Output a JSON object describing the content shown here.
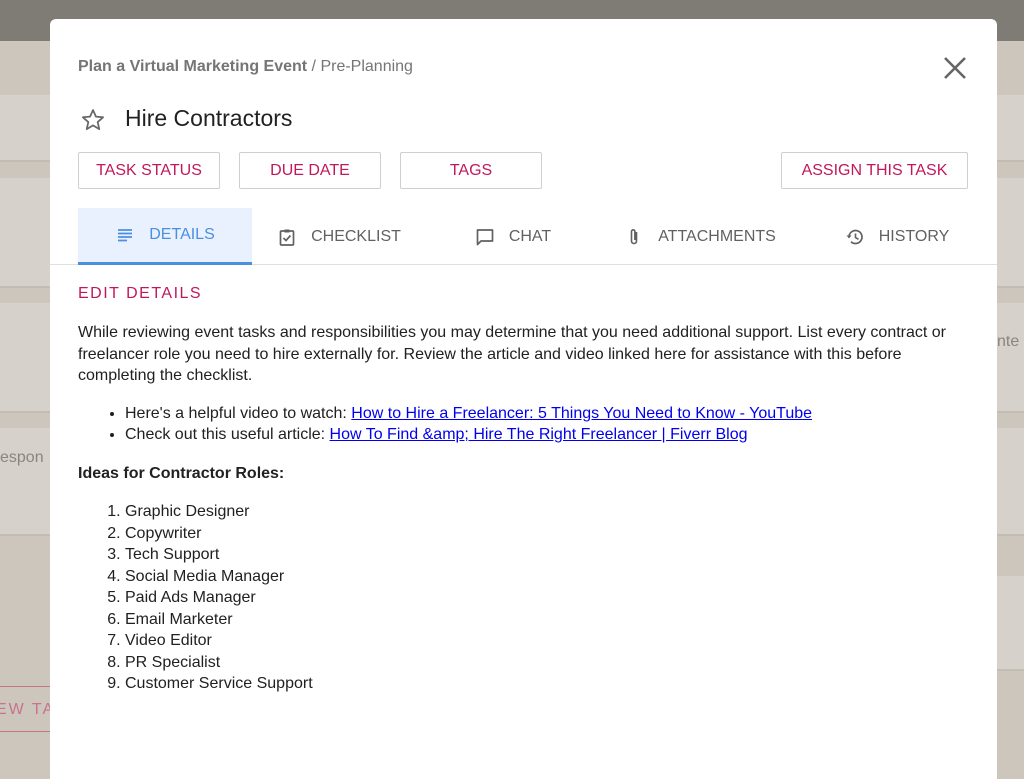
{
  "background": {
    "partial_text_1": "espon",
    "partial_text_2": "nte",
    "partial_button": "EW TA"
  },
  "breadcrumb": {
    "project": "Plan a Virtual Marketing Event",
    "separator": " / ",
    "section": "Pre-Planning"
  },
  "task": {
    "title": "Hire Contractors",
    "star_icon": "star-outline-icon"
  },
  "buttons": {
    "task_status": "TASK STATUS",
    "due_date": "DUE DATE",
    "tags": "TAGS",
    "assign": "ASSIGN THIS TASK"
  },
  "tabs": [
    {
      "label": "DETAILS",
      "icon": "notes-icon",
      "active": true
    },
    {
      "label": "CHECKLIST",
      "icon": "clipboard-check-icon"
    },
    {
      "label": "CHAT",
      "icon": "chat-bubble-icon"
    },
    {
      "label": "ATTACHMENTS",
      "icon": "paperclip-icon"
    },
    {
      "label": "HISTORY",
      "icon": "history-icon"
    }
  ],
  "details": {
    "section_title": "EDIT DETAILS",
    "description": "While reviewing event tasks and responsibilities you may determine that you need additional support. List every contract or freelancer role you need to hire externally for. Review the article and video linked here for assistance with this before completing the checklist.",
    "links": [
      {
        "prefix": "Here's a helpful video to watch: ",
        "text": "How to Hire a Freelancer: 5 Things You Need to Know - YouTube"
      },
      {
        "prefix": "Check out this useful article: ",
        "text": "How To Find &amp; Hire The Right Freelancer | Fiverr Blog"
      }
    ],
    "ideas_heading": "Ideas for Contractor Roles:",
    "roles": [
      "Graphic Designer",
      "Copywriter",
      "Tech Support",
      "Social Media Manager",
      "Paid Ads Manager",
      "Email Marketer",
      "Video Editor",
      "PR Specialist",
      "Customer Service Support"
    ]
  },
  "colors": {
    "accent": "#c2185b",
    "active_tab": "#4a90e2",
    "active_tab_bg": "#e8f1fd"
  }
}
